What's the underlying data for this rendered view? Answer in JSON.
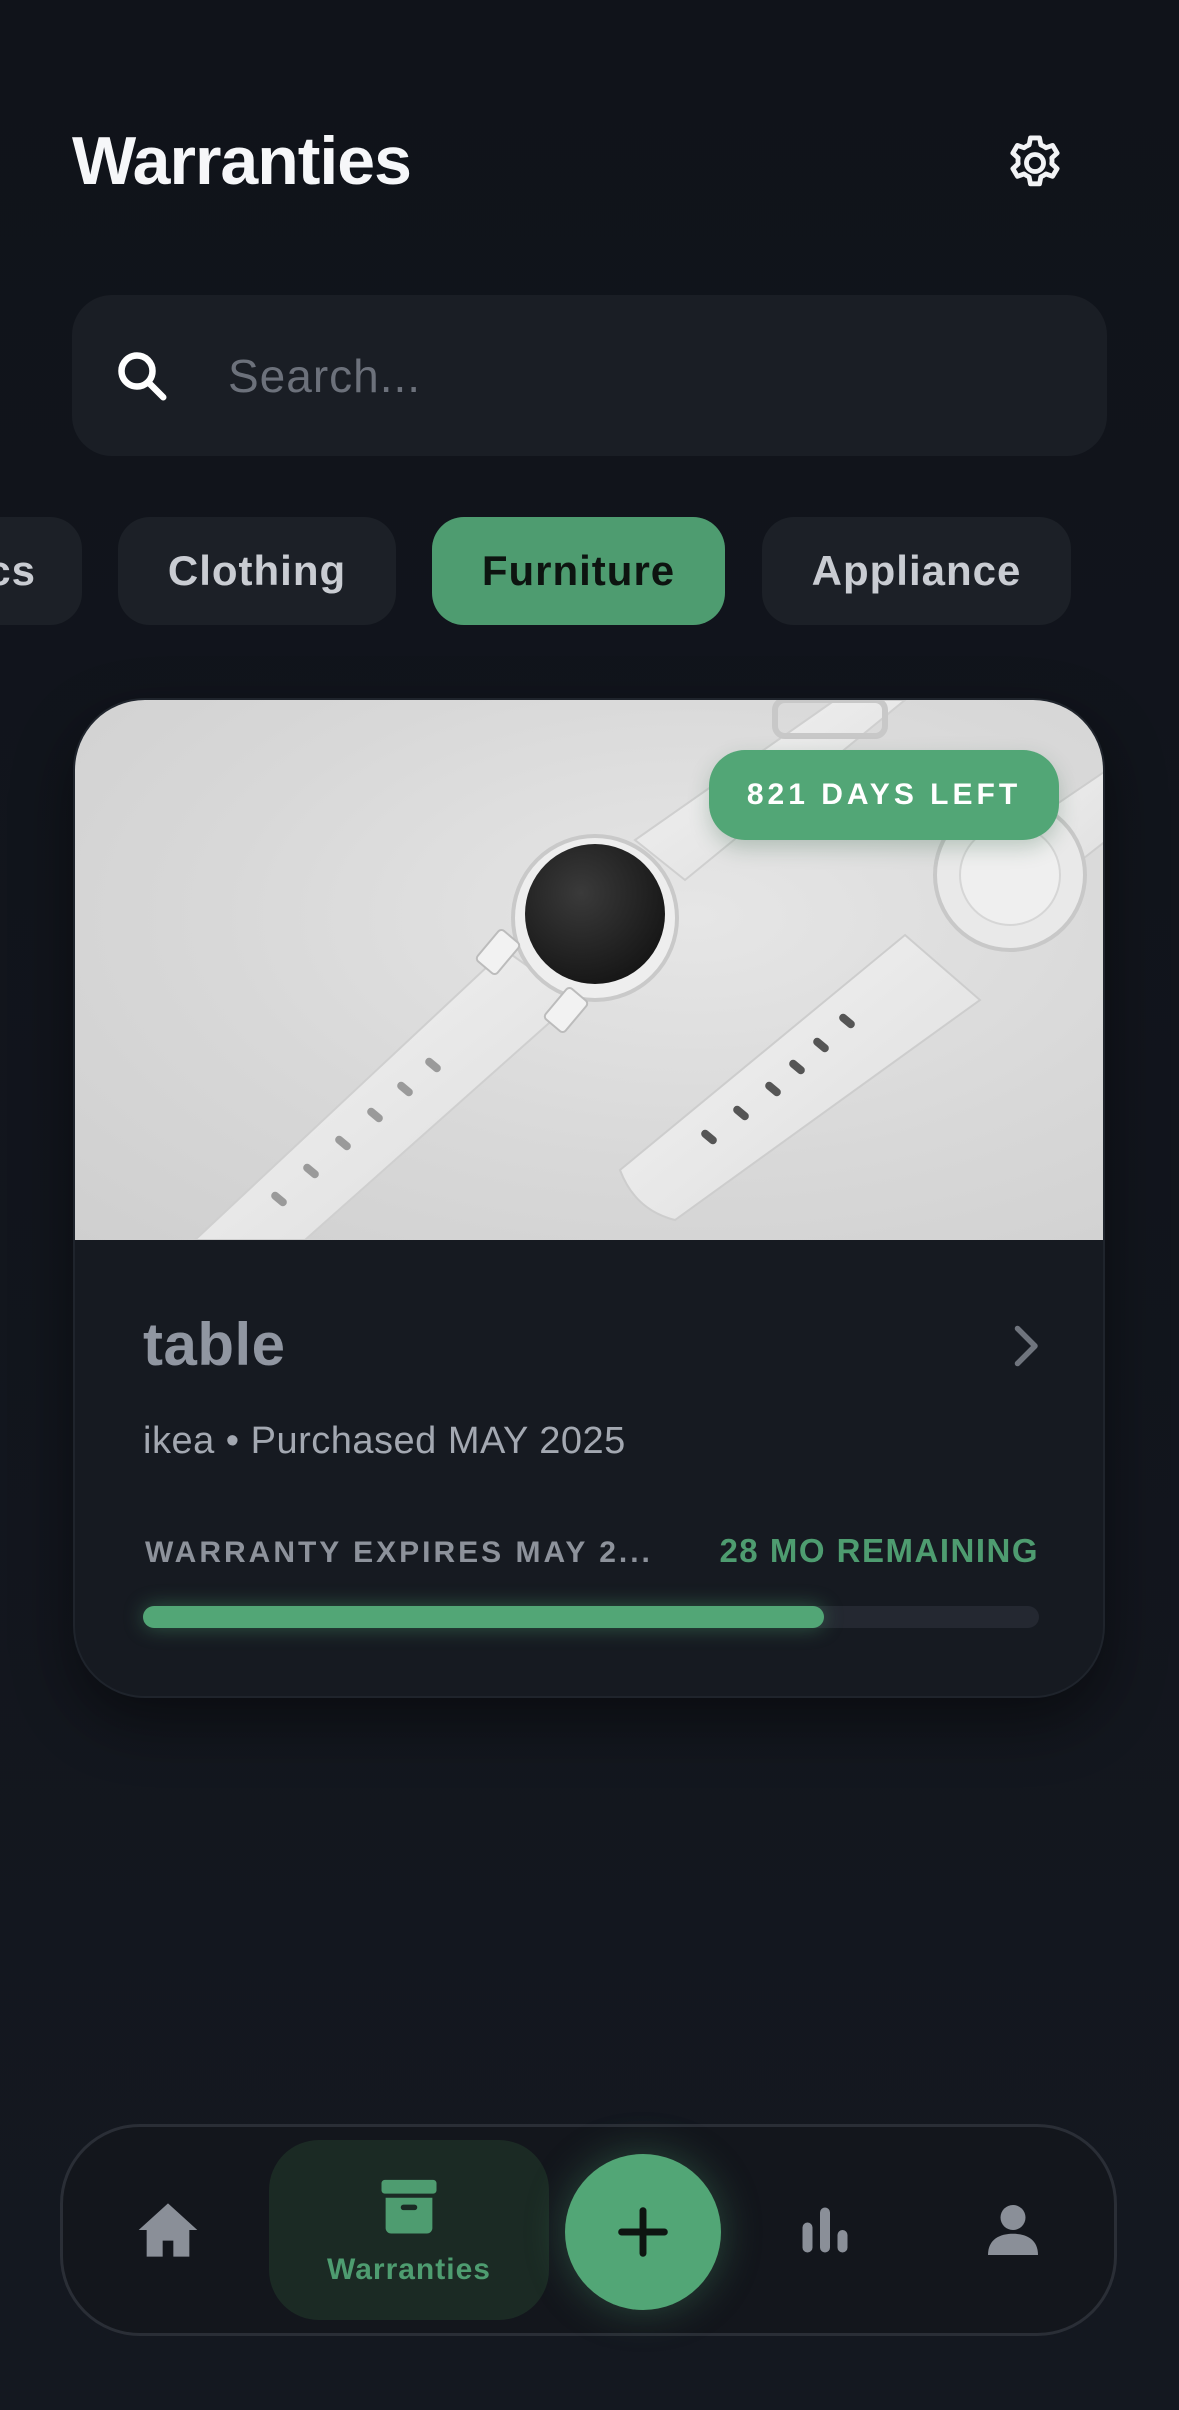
{
  "header": {
    "title": "Warranties",
    "settings_icon": "gear-icon"
  },
  "search": {
    "placeholder": "Search...",
    "value": "",
    "icon": "search-icon"
  },
  "categories": {
    "items": [
      {
        "label": "cs",
        "active": false
      },
      {
        "label": "Clothing",
        "active": false
      },
      {
        "label": "Furniture",
        "active": true
      },
      {
        "label": "Appliance",
        "active": false
      }
    ]
  },
  "card": {
    "badge": "821 DAYS LEFT",
    "title": "table",
    "meta": "ikea • Purchased MAY 2025",
    "expires": "WARRANTY EXPIRES MAY 2...",
    "remaining": "28 MO REMAINING",
    "progress": 0.76,
    "image": "smartwatch-photo"
  },
  "nav": {
    "items": [
      {
        "icon": "home-icon",
        "label": ""
      },
      {
        "icon": "archive-box-icon",
        "label": "Warranties",
        "active": true
      },
      {
        "icon": "plus-icon",
        "label": ""
      },
      {
        "icon": "bar-chart-icon",
        "label": ""
      },
      {
        "icon": "user-icon",
        "label": ""
      }
    ]
  },
  "colors": {
    "background": "#111419",
    "accent": "#52a676",
    "card": "#161a21",
    "chip": "#1c2027"
  }
}
